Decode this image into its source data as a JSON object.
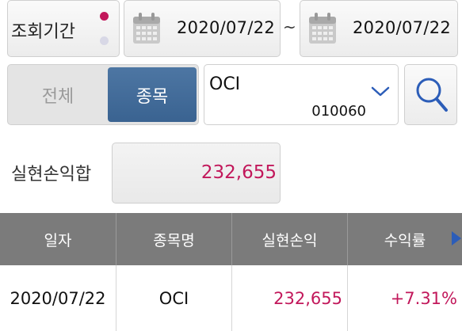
{
  "period": {
    "label": "조회기간"
  },
  "date_range": {
    "start": "2020/07/22",
    "separator": "~",
    "end": "2020/07/22"
  },
  "segment": {
    "all_label": "전체",
    "stock_label": "종목",
    "selected": "종목"
  },
  "stock": {
    "name": "OCI",
    "code": "010060"
  },
  "summary": {
    "label": "실현손익합",
    "value": "232,655"
  },
  "table": {
    "headers": [
      "일자",
      "종목명",
      "실현손익",
      "수익률"
    ],
    "rows": [
      {
        "date": "2020/07/22",
        "name": "OCI",
        "realized_pnl": "232,655",
        "return_rate": "+7.31%"
      }
    ]
  },
  "colors": {
    "accent": "#3a6391",
    "positive": "#c2185b",
    "header_bg": "#7b7b7b"
  },
  "icons": [
    "calendar-icon",
    "chevron-down-icon",
    "search-icon",
    "scroll-right-arrow-icon"
  ]
}
